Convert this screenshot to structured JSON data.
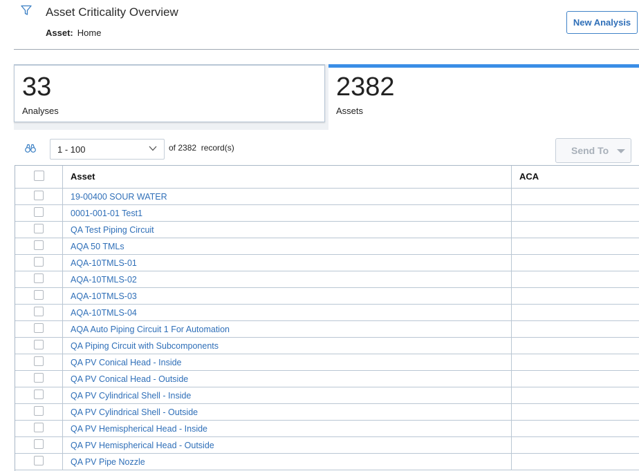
{
  "header": {
    "title": "Asset Criticality Overview",
    "asset_label": "Asset:",
    "asset_value": "Home",
    "new_analysis": "New Analysis"
  },
  "tiles": {
    "analyses": {
      "count": "33",
      "caption": "Analyses"
    },
    "assets": {
      "count": "2382",
      "caption": "Assets",
      "accent": "#3a8ee6"
    }
  },
  "toolbar": {
    "range": "1 - 100",
    "records": "of 2382  record(s)",
    "send_to": "Send To"
  },
  "grid": {
    "columns": [
      "Asset",
      "ACA"
    ],
    "rows": [
      "19-00400 SOUR WATER",
      "0001-001-01 Test1",
      "QA Test Piping Circuit",
      "AQA 50 TMLs",
      "AQA-10TMLS-01",
      "AQA-10TMLS-02",
      "AQA-10TMLS-03",
      "AQA-10TMLS-04",
      "AQA Auto Piping Circuit 1 For Automation",
      "QA Piping Circuit with Subcomponents",
      "QA PV Conical Head - Inside",
      "QA PV Conical Head - Outside",
      "QA PV Cylindrical Shell - Inside",
      "QA PV Cylindrical Shell - Outside",
      "QA PV Hemispherical Head - Inside",
      "QA PV Hemispherical Head - Outside",
      "QA PV Pipe Nozzle"
    ]
  },
  "colors": {
    "link": "#2f6fb8",
    "accent": "#3a8ee6"
  }
}
